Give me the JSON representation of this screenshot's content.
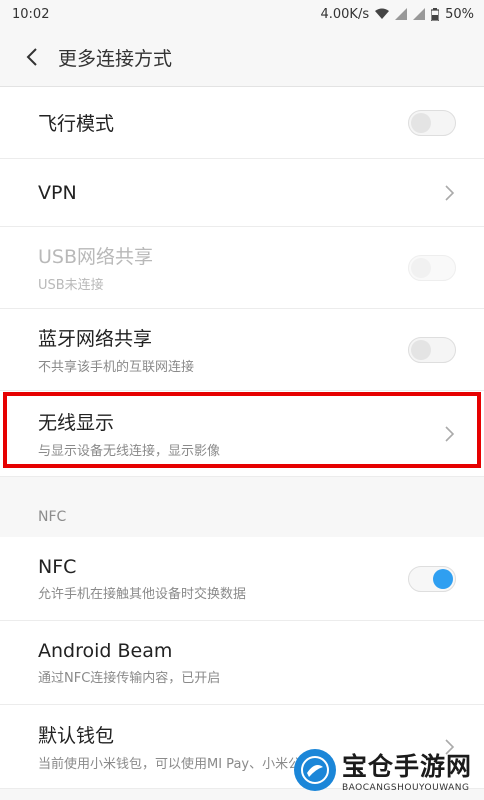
{
  "status_bar": {
    "time": "10:02",
    "speed": "4.00K/s",
    "battery": "50%"
  },
  "header": {
    "title": "更多连接方式",
    "back_icon": "back-arrow-icon"
  },
  "rows": [
    {
      "title": "飞行模式",
      "subtitle": "",
      "control": "toggle",
      "state": "off"
    },
    {
      "title": "VPN",
      "subtitle": "",
      "control": "chevron"
    },
    {
      "title": "USB网络共享",
      "subtitle": "USB未连接",
      "control": "toggle",
      "state": "disabled"
    },
    {
      "title": "蓝牙网络共享",
      "subtitle": "不共享该手机的互联网连接",
      "control": "toggle",
      "state": "off"
    },
    {
      "title": "无线显示",
      "subtitle": "与显示设备无线连接，显示影像",
      "control": "chevron"
    }
  ],
  "nfc_section": {
    "label": "NFC",
    "rows": [
      {
        "title": "NFC",
        "subtitle": "允许手机在接触其他设备时交换数据",
        "control": "toggle",
        "state": "on"
      },
      {
        "title": "Android Beam",
        "subtitle": "通过NFC连接传输内容，已开启",
        "control": "none"
      },
      {
        "title": "默认钱包",
        "subtitle": "当前使用小米钱包，可以使用MI Pay、小米公交卡",
        "control": "chevron"
      }
    ]
  },
  "colors": {
    "accent": "#2f9ff1",
    "highlight": "#e60000"
  },
  "watermark": {
    "title": "宝仓手游网",
    "subtitle": "BAOCANGSHOUYOUWANG"
  }
}
